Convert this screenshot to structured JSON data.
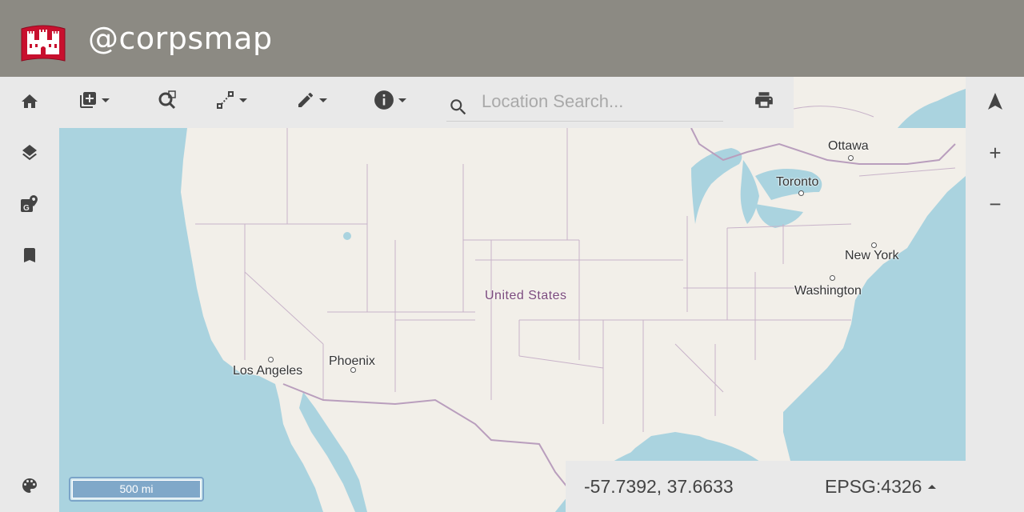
{
  "header": {
    "title": "@corpsmap",
    "bg_color": "#8c8a83",
    "logo_icon": "castle-logo"
  },
  "left_rail": {
    "items": [
      {
        "icon": "home-icon"
      },
      {
        "icon": "layers-icon"
      },
      {
        "icon": "geo-map-marker-icon"
      },
      {
        "icon": "bookmark-icon"
      },
      {
        "icon": "palette-icon"
      }
    ]
  },
  "toolbar": {
    "items": [
      {
        "icon": "add-layer-icon",
        "has_dropdown": true
      },
      {
        "icon": "zoom-to-area-icon",
        "has_dropdown": false
      },
      {
        "icon": "measure-icon",
        "has_dropdown": true
      },
      {
        "icon": "draw-pencil-icon",
        "has_dropdown": true
      },
      {
        "icon": "info-icon",
        "has_dropdown": true
      },
      {
        "icon": "print-icon",
        "has_dropdown": false
      }
    ],
    "search": {
      "placeholder": "Location Search...",
      "value": "",
      "icon": "search-icon"
    }
  },
  "right_rail": {
    "north": "▲",
    "zoom_in": "+",
    "zoom_out": "−"
  },
  "map": {
    "country_label": "United States",
    "cities": [
      {
        "name": "Ottawa"
      },
      {
        "name": "Toronto"
      },
      {
        "name": "New York"
      },
      {
        "name": "Washington"
      },
      {
        "name": "Phoenix"
      },
      {
        "name": "Los Angeles"
      }
    ],
    "water_color": "#aad3df",
    "land_color": "#f2efe9",
    "border_color": "#c8b3c9"
  },
  "scale": {
    "label": "500 mi"
  },
  "status": {
    "coordinates": "-57.7392, 37.6633",
    "projection": "EPSG:4326"
  }
}
